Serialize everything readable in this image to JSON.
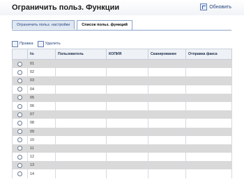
{
  "header": {
    "title": "Ограничить польз. Функции",
    "refresh_label": "Обновить"
  },
  "tabs": [
    {
      "label": "Ограничить польз. настройки",
      "active": false
    },
    {
      "label": "Список польз. функций",
      "active": true
    }
  ],
  "actions": {
    "edit_label": "Правка",
    "delete_label": "Удалить"
  },
  "table": {
    "columns": [
      "",
      "№",
      "Пользователь",
      "КОПИЯ",
      "Сканирование",
      "Отправка факса"
    ],
    "rows": [
      "01",
      "02",
      "03",
      "04",
      "05",
      "06",
      "07",
      "08",
      "09",
      "10",
      "11",
      "12",
      "13",
      "14"
    ]
  }
}
